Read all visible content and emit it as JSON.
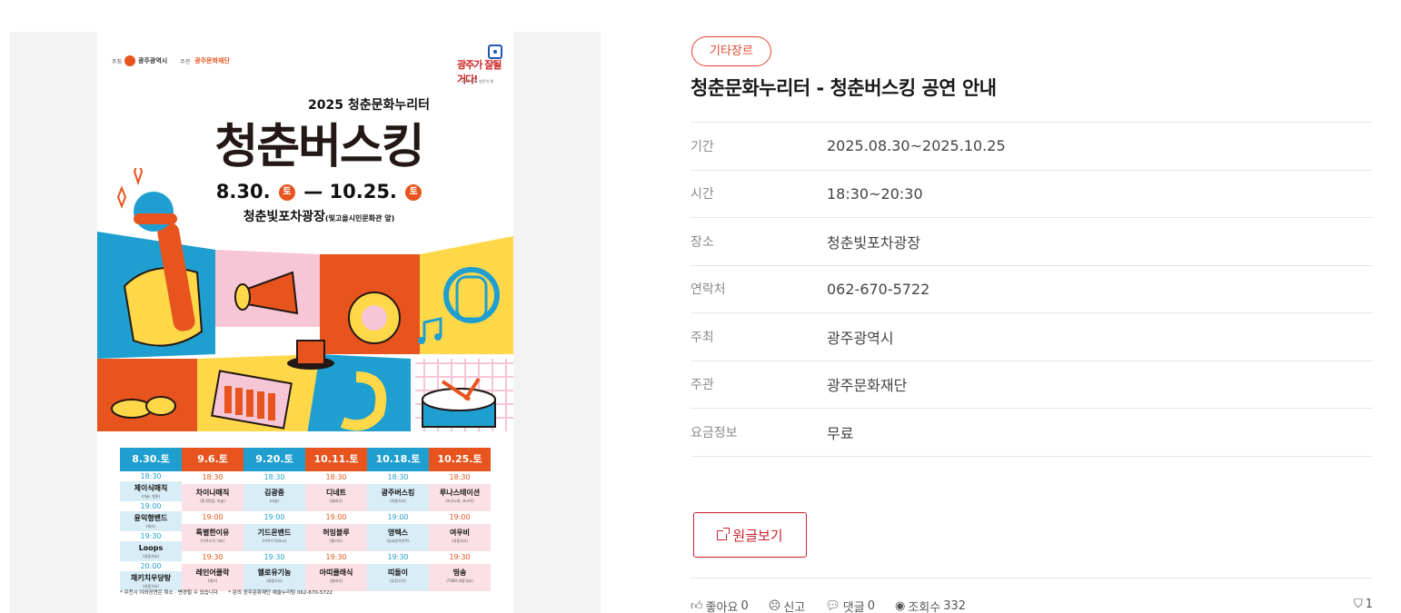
{
  "poster": {
    "host_label": "주최",
    "host": "광주광역시",
    "organizer_label": "주관",
    "organizer": "광주문화재단",
    "brand_mark": "광주가 잘될 거다!",
    "brand_sub": "2025 광주 방문의 해",
    "year_line": "2025 청춘문화누리터",
    "title": "청춘버스킹",
    "date_start": "8.30.",
    "date_end": "10.25.",
    "day_badge": "토",
    "dash": "—",
    "venue": "청춘빛포차광장",
    "venue_note": "(빛고을시민문화관 앞)",
    "schedule": [
      {
        "date": "8.30.토",
        "color": "#1f9fd0",
        "slots": [
          {
            "time": "18:30",
            "name": "제이식매직",
            "sub": "(마술, 벌룬)"
          },
          {
            "time": "19:00",
            "name": "윤익형밴드",
            "sub": "(재즈)"
          },
          {
            "time": "19:30",
            "name": "Loops",
            "sub": "(대중가요)"
          },
          {
            "time": "20:00",
            "name": "채키치우당탕",
            "sub": "(대중가요)"
          }
        ]
      },
      {
        "date": "9.6.토",
        "color": "#e8541e",
        "slots": [
          {
            "time": "18:30",
            "name": "차이나매직",
            "sub": "(중국변검, 마술)"
          },
          {
            "time": "19:00",
            "name": "특별한이유",
            "sub": "(어쿠스틱 기타)"
          },
          {
            "time": "19:30",
            "name": "레인어클락",
            "sub": "(재즈)"
          }
        ]
      },
      {
        "date": "9.20.토",
        "color": "#1f9fd0",
        "slots": [
          {
            "time": "18:30",
            "name": "김광중",
            "sub": "(마술)"
          },
          {
            "time": "19:00",
            "name": "기드온밴드",
            "sub": "(어쿠스틱/포크)"
          },
          {
            "time": "19:30",
            "name": "헬로유기농",
            "sub": "(대중가요)"
          }
        ]
      },
      {
        "date": "10.11.토",
        "color": "#e8541e",
        "slots": [
          {
            "time": "18:30",
            "name": "디네트",
            "sub": "(클래식)"
          },
          {
            "time": "19:00",
            "name": "허밍블루",
            "sub": "(통기타)"
          },
          {
            "time": "19:30",
            "name": "아띠클래식",
            "sub": "(클래식)"
          }
        ]
      },
      {
        "date": "10.18.토",
        "color": "#1f9fd0",
        "slots": [
          {
            "time": "18:30",
            "name": "광주버스킹",
            "sub": "(대중가요)"
          },
          {
            "time": "19:00",
            "name": "영텍스",
            "sub": "(실내관악연주)"
          },
          {
            "time": "19:30",
            "name": "띠돌이",
            "sub": "(퓨전국악)"
          }
        ]
      },
      {
        "date": "10.25.토",
        "color": "#e8541e",
        "slots": [
          {
            "time": "18:30",
            "name": "루나스테이션",
            "sub": "(보사노바, 포크락)"
          },
          {
            "time": "19:00",
            "name": "여우비",
            "sub": "(대중가요)"
          },
          {
            "time": "19:30",
            "name": "띵송",
            "sub": "(7080 대중가요)"
          }
        ]
      }
    ],
    "footnote_1": "* 우천시 야외공연은 취소 · 변경될 수 있습니다.",
    "footnote_2": "* 문의 광주문화재단 예술누리팀 062-670-5722"
  },
  "detail": {
    "category": "기타장르",
    "title": "청춘문화누리터 - 청춘버스킹 공연 안내",
    "rows": [
      {
        "key": "기간",
        "value": "2025.08.30~2025.10.25"
      },
      {
        "key": "시간",
        "value": "18:30~20:30"
      },
      {
        "key": "장소",
        "value": "청춘빛포차광장"
      },
      {
        "key": "연락처",
        "value": "062-670-5722"
      },
      {
        "key": "주최",
        "value": "광주광역시"
      },
      {
        "key": "주관",
        "value": "광주문화재단"
      },
      {
        "key": "요금정보",
        "value": "무료"
      }
    ],
    "original_button": "원글보기"
  },
  "stats": {
    "like_label": "좋아요",
    "like_count": "0",
    "report_label": "신고",
    "comment_label": "댓글",
    "comment_count": "0",
    "views_label": "조회수",
    "views_count": "332",
    "bookmark_count": "1"
  },
  "colors": {
    "accent_red": "#e5432f",
    "button_red": "#c8202c",
    "poster_blue": "#1f9fd0",
    "poster_orange": "#e8541e",
    "poster_yellow": "#ffd84a",
    "poster_pink": "#f7c6d6"
  }
}
